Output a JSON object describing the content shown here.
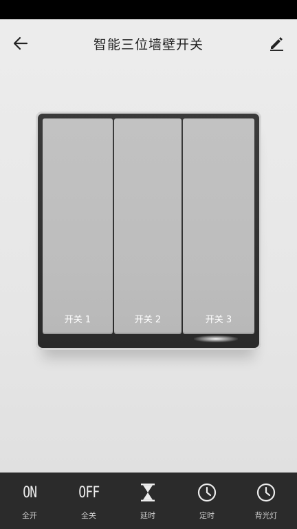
{
  "header": {
    "title": "智能三位墙壁开关",
    "back_icon": "back-arrow-icon",
    "edit_icon": "pencil-icon"
  },
  "switches": [
    {
      "label": "开关 1"
    },
    {
      "label": "开关 2"
    },
    {
      "label": "开关 3"
    }
  ],
  "bottom_bar": {
    "items": [
      {
        "icon_text": "ON",
        "label": "全开"
      },
      {
        "icon_text": "OFF",
        "label": "全关"
      },
      {
        "icon": "hourglass-icon",
        "label": "延时"
      },
      {
        "icon": "clock-icon",
        "label": "定时"
      },
      {
        "icon": "clock-icon",
        "label": "背光灯"
      }
    ]
  },
  "colors": {
    "panel_frame": "#2f2f2f",
    "rocker": "#bfbfbf",
    "bottom_bar": "#2b2b2b"
  }
}
